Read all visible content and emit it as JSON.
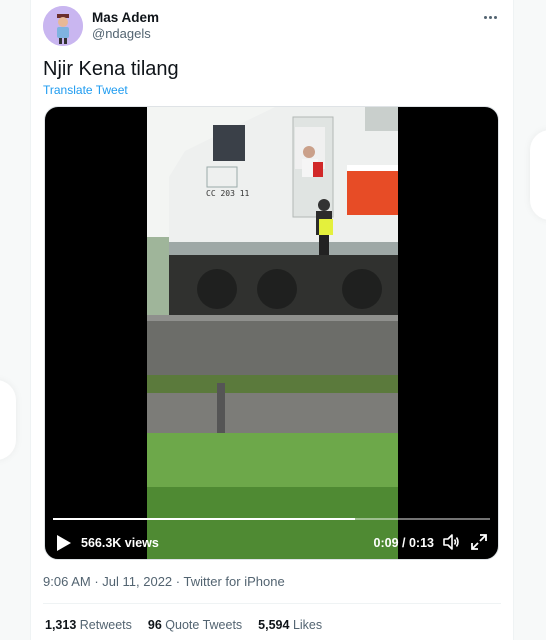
{
  "author": {
    "name": "Mas Adem",
    "handle": "@ndagels"
  },
  "tweet": {
    "text": "Njir Kena tilang",
    "translate_label": "Translate Tweet"
  },
  "video": {
    "views": "566.3K views",
    "time": "0:09 / 0:13",
    "progress": 0.69,
    "locomotive_number": "CC 203 11"
  },
  "meta": {
    "time": "9:06 AM",
    "date": "Jul 11, 2022",
    "source": "Twitter for iPhone",
    "separator": "·"
  },
  "stats": [
    {
      "count": "1,313",
      "label": "Retweets"
    },
    {
      "count": "96",
      "label": "Quote Tweets"
    },
    {
      "count": "5,594",
      "label": "Likes"
    }
  ],
  "colors": {
    "accent": "#1d9bf0",
    "text_secondary": "#536471",
    "avatar_bg": "#c9b6f0"
  }
}
